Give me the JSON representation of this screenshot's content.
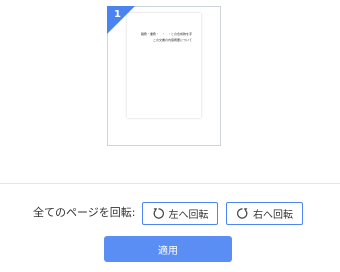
{
  "preview": {
    "page_number": "1",
    "document_lines": [
      "職務・業務・　・　・との合成物を手",
      "この文書の内容概要について"
    ]
  },
  "rotate_all": {
    "label": "全てのページを回転:",
    "left_label": "左へ回転",
    "right_label": "右へ回転"
  },
  "apply": {
    "label": "適用"
  },
  "colors": {
    "accent": "#5b8ef5",
    "badge": "#4a84f0",
    "border": "#4f87f2"
  }
}
